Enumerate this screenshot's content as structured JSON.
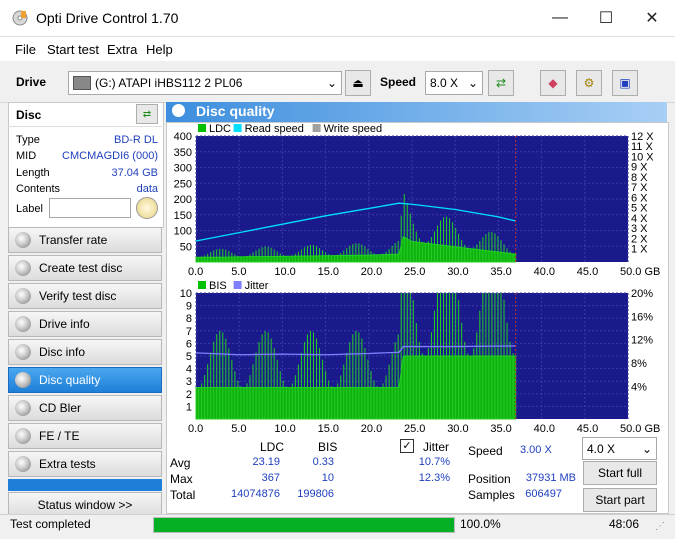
{
  "window": {
    "title": "Opti Drive Control 1.70",
    "min": "—",
    "max": "☐",
    "close": "✕"
  },
  "menu": [
    "File",
    "Start test",
    "Extra",
    "Help"
  ],
  "toolbar": {
    "drive_label": "Drive",
    "drive_value": "(G:)  ATAPI iHBS112  2 PL06",
    "speed_label": "Speed",
    "speed_value": "8.0 X"
  },
  "disc": {
    "title": "Disc",
    "rows": [
      {
        "label": "Type",
        "value": "BD-R DL"
      },
      {
        "label": "MID",
        "value": "CMCMAGDI6 (000)"
      },
      {
        "label": "Length",
        "value": "37.04 GB"
      },
      {
        "label": "Contents",
        "value": "data"
      }
    ],
    "label_field": "Label"
  },
  "nav": [
    "Transfer rate",
    "Create test disc",
    "Verify test disc",
    "Drive info",
    "Disc info",
    "Disc quality",
    "CD Bler",
    "FE / TE",
    "Extra tests"
  ],
  "nav_active": 5,
  "status_window": "Status window >>",
  "main": {
    "title": "Disc quality"
  },
  "chart_data": [
    {
      "type": "area",
      "legend": [
        "LDC",
        "Read speed",
        "Write speed"
      ],
      "legend_colors": [
        "#00c000",
        "#00e0ff",
        "#a0a0a0"
      ],
      "x_ticks": [
        "0.0",
        "5.0",
        "10.0",
        "15.0",
        "20.0",
        "25.0",
        "30.0",
        "35.0",
        "40.0",
        "45.0",
        "50.0 GB"
      ],
      "y_ticks": [
        "400",
        "350",
        "300",
        "250",
        "200",
        "150",
        "100",
        "50"
      ],
      "y2_ticks": [
        "12 X",
        "11 X",
        "10 X",
        "9 X",
        "8 X",
        "7 X",
        "6 X",
        "5 X",
        "4 X",
        "3 X",
        "2 X",
        "1 X"
      ],
      "xlim": [
        0,
        50
      ],
      "ylim": [
        0,
        400
      ],
      "series": [
        {
          "name": "LDC",
          "x": [
            0,
            3,
            6,
            10,
            15,
            20,
            23.5,
            24,
            25,
            28,
            31,
            34,
            37
          ],
          "values": [
            15,
            15,
            17,
            18,
            20,
            22,
            25,
            80,
            65,
            55,
            45,
            35,
            25
          ]
        },
        {
          "name": "Read speed",
          "x": [
            0,
            5,
            10,
            15,
            20,
            23.5,
            25,
            30,
            35,
            37
          ],
          "values": [
            2.0,
            2.8,
            3.6,
            4.4,
            5.1,
            5.6,
            5.5,
            5.0,
            4.3,
            3.9
          ]
        }
      ]
    },
    {
      "type": "area",
      "legend": [
        "BIS",
        "Jitter"
      ],
      "legend_colors": [
        "#00c000",
        "#8080ff"
      ],
      "x_ticks": [
        "0.0",
        "5.0",
        "10.0",
        "15.0",
        "20.0",
        "25.0",
        "30.0",
        "35.0",
        "40.0",
        "45.0",
        "50.0 GB"
      ],
      "y_ticks": [
        "10",
        "9",
        "8",
        "7",
        "6",
        "5",
        "4",
        "3",
        "2",
        "1"
      ],
      "y2_ticks": [
        "20%",
        "16%",
        "12%",
        "8%",
        "4%"
      ],
      "xlim": [
        0,
        50
      ],
      "ylim": [
        0,
        10
      ],
      "series": [
        {
          "name": "BIS",
          "x": [
            0,
            5,
            10,
            15,
            20,
            23.5,
            24,
            30,
            37
          ],
          "values": [
            2.5,
            2.5,
            2.5,
            2.5,
            2.5,
            2.5,
            5,
            5,
            5
          ]
        },
        {
          "name": "Jitter",
          "x": [
            0,
            5,
            10,
            15,
            20,
            23.5,
            24,
            30,
            37
          ],
          "values": [
            10.5,
            10.2,
            10.3,
            10.2,
            10.4,
            10.6,
            11.5,
            11.5,
            11.6
          ]
        }
      ]
    }
  ],
  "stats": {
    "cols": [
      "LDC",
      "BIS"
    ],
    "jitter_label": "Jitter",
    "rows": [
      {
        "label": "Avg",
        "ldc": "23.19",
        "bis": "0.33",
        "jitter": "10.7%"
      },
      {
        "label": "Max",
        "ldc": "367",
        "bis": "10",
        "jitter": "12.3%"
      },
      {
        "label": "Total",
        "ldc": "14074876",
        "bis": "199806",
        "jitter": ""
      }
    ],
    "speed_label": "Speed",
    "speed_value": "3.00 X",
    "speed_select": "4.0 X",
    "position_label": "Position",
    "position_value": "37931 MB",
    "samples_label": "Samples",
    "samples_value": "606497",
    "start_full": "Start full",
    "start_part": "Start part"
  },
  "status": {
    "text": "Test completed",
    "progress": 1.0,
    "progress_text": "100.0%",
    "time": "48:06"
  }
}
